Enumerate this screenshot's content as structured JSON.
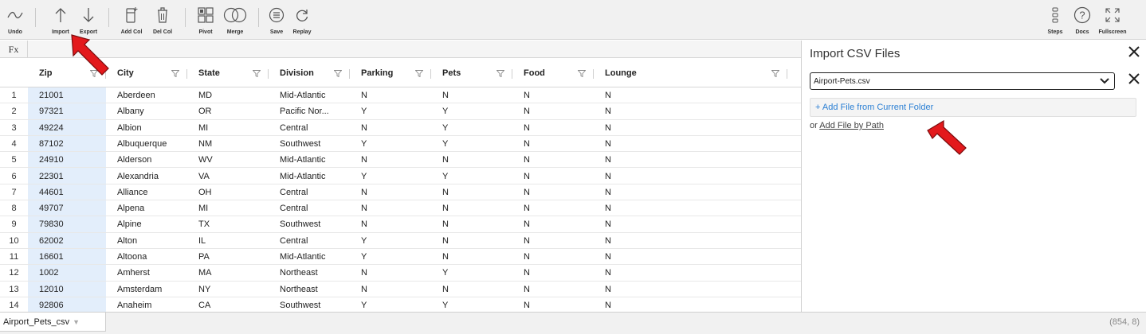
{
  "toolbar": {
    "undo": "Undo",
    "import": "Import",
    "export": "Export",
    "add_col": "Add Col",
    "del_col": "Del Col",
    "pivot": "Pivot",
    "merge": "Merge",
    "save": "Save",
    "replay": "Replay",
    "steps": "Steps",
    "docs": "Docs",
    "fullscreen": "Fullscreen"
  },
  "formula_bar": {
    "label": "Fx"
  },
  "columns": [
    "Zip",
    "City",
    "State",
    "Division",
    "Parking",
    "Pets",
    "Food",
    "Lounge"
  ],
  "rows": [
    {
      "num": "1",
      "cells": [
        "21001",
        "Aberdeen",
        "MD",
        "Mid-Atlantic",
        "N",
        "N",
        "N",
        "N"
      ]
    },
    {
      "num": "2",
      "cells": [
        "97321",
        "Albany",
        "OR",
        "Pacific Nor...",
        "Y",
        "Y",
        "N",
        "N"
      ]
    },
    {
      "num": "3",
      "cells": [
        "49224",
        "Albion",
        "MI",
        "Central",
        "N",
        "Y",
        "N",
        "N"
      ]
    },
    {
      "num": "4",
      "cells": [
        "87102",
        "Albuquerque",
        "NM",
        "Southwest",
        "Y",
        "Y",
        "N",
        "N"
      ]
    },
    {
      "num": "5",
      "cells": [
        "24910",
        "Alderson",
        "WV",
        "Mid-Atlantic",
        "N",
        "N",
        "N",
        "N"
      ]
    },
    {
      "num": "6",
      "cells": [
        "22301",
        "Alexandria",
        "VA",
        "Mid-Atlantic",
        "Y",
        "Y",
        "N",
        "N"
      ]
    },
    {
      "num": "7",
      "cells": [
        "44601",
        "Alliance",
        "OH",
        "Central",
        "N",
        "N",
        "N",
        "N"
      ]
    },
    {
      "num": "8",
      "cells": [
        "49707",
        "Alpena",
        "MI",
        "Central",
        "N",
        "N",
        "N",
        "N"
      ]
    },
    {
      "num": "9",
      "cells": [
        "79830",
        "Alpine",
        "TX",
        "Southwest",
        "N",
        "N",
        "N",
        "N"
      ]
    },
    {
      "num": "10",
      "cells": [
        "62002",
        "Alton",
        "IL",
        "Central",
        "Y",
        "N",
        "N",
        "N"
      ]
    },
    {
      "num": "11",
      "cells": [
        "16601",
        "Altoona",
        "PA",
        "Mid-Atlantic",
        "Y",
        "N",
        "N",
        "N"
      ]
    },
    {
      "num": "12",
      "cells": [
        "1002",
        "Amherst",
        "MA",
        "Northeast",
        "N",
        "Y",
        "N",
        "N"
      ]
    },
    {
      "num": "13",
      "cells": [
        "12010",
        "Amsterdam",
        "NY",
        "Northeast",
        "N",
        "N",
        "N",
        "N"
      ]
    },
    {
      "num": "14",
      "cells": [
        "92806",
        "Anaheim",
        "CA",
        "Southwest",
        "Y",
        "Y",
        "N",
        "N"
      ]
    }
  ],
  "panel": {
    "title": "Import CSV Files",
    "selected_file": "Airport-Pets.csv",
    "add_current": "+ Add File from Current Folder",
    "or_text": "or",
    "add_path": "Add File by Path"
  },
  "sheet": {
    "tab_name": "Airport_Pets_csv",
    "dimensions": "(854, 8)"
  },
  "colors": {
    "accent": "#2a7fd4",
    "annotation_arrow": "#e3191c",
    "selected_column": "#e3eefb"
  }
}
